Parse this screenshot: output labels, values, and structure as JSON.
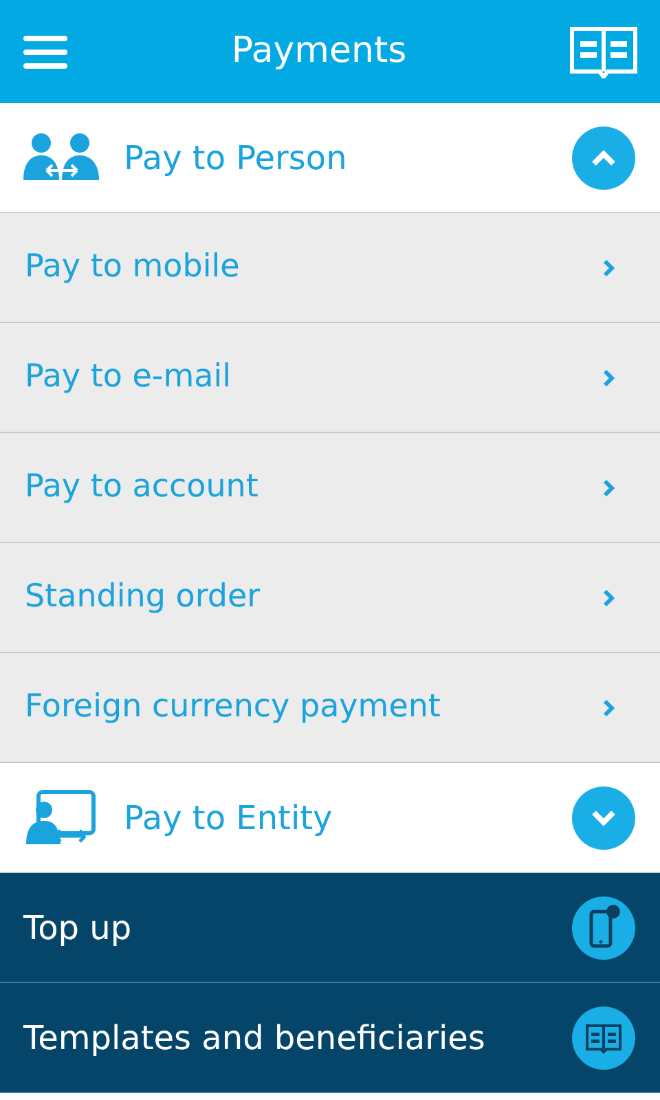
{
  "app_bar": {
    "title": "Payments"
  },
  "sections": [
    {
      "title": "Pay to Person",
      "expanded": true,
      "items": [
        "Pay to mobile",
        "Pay to e-mail",
        "Pay to account",
        "Standing order",
        "Foreign currency payment"
      ]
    },
    {
      "title": "Pay to Entity",
      "expanded": false
    }
  ],
  "links": [
    {
      "label": "Top up"
    },
    {
      "label": "Templates and beneficiaries"
    }
  ]
}
